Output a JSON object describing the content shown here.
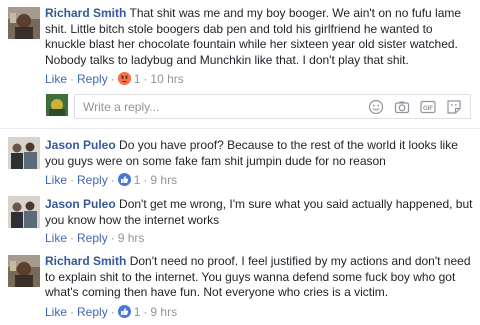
{
  "comments": [
    {
      "author": "Richard Smith",
      "text": "That shit was me and my boy booger. We ain't on no fufu lame shit. Little bitch stole boogers dab pen and told his girlfriend he wanted to knuckle blast her chocolate fountain while her sixteen year old sister watched. Nobody talks to ladybug and Munchkin like that. I don't play that shit.",
      "like_label": "Like",
      "reply_label": "Reply",
      "reaction_icon": "angry-reaction-icon",
      "reaction_color": "#f7714b",
      "reaction_count": "1",
      "time": "10 hrs"
    },
    {
      "author": "Jason Puleo",
      "text": "Do you have proof? Because to the rest of the world it looks like you guys were on some fake fam shit jumpin dude for no reason",
      "like_label": "Like",
      "reply_label": "Reply",
      "reaction_icon": "like-reaction-icon",
      "reaction_color": "#4a76d6",
      "reaction_count": "1",
      "time": "9 hrs"
    },
    {
      "author": "Jason Puleo",
      "text": "Don't get me wrong, I'm sure what you said actually happened, but you know how the internet works",
      "like_label": "Like",
      "reply_label": "Reply",
      "time": "9 hrs"
    },
    {
      "author": "Richard Smith",
      "text": "Don't need no proof. I feel justified by my actions and don't need to explain shit to the internet. You guys wanna defend some fuck boy who got what's coming then have fun. Not everyone who cries is a victim.",
      "like_label": "Like",
      "reply_label": "Reply",
      "reaction_icon": "like-reaction-icon",
      "reaction_color": "#4a76d6",
      "reaction_count": "1",
      "time": "9 hrs"
    }
  ],
  "reply_box": {
    "placeholder": "Write a reply...",
    "icons": [
      "emoji-icon",
      "camera-icon",
      "gif-icon",
      "sticker-icon"
    ]
  }
}
